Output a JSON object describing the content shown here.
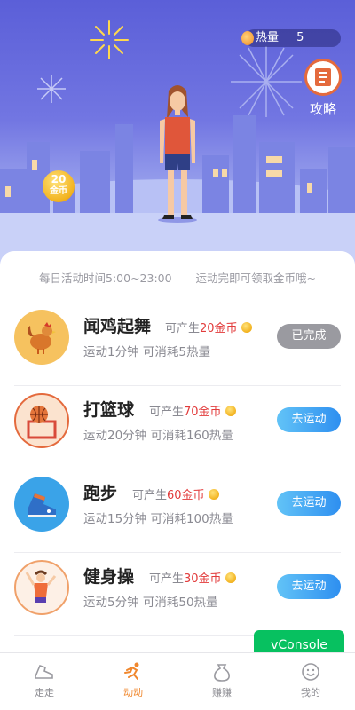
{
  "hero": {
    "heat_label": "热量",
    "heat_value": "5",
    "guide_label": "攻略",
    "coin_amount": "20",
    "coin_unit": "金币"
  },
  "hints": {
    "left": "每日活动时间5:00~23:00",
    "right": "运动完即可领取金币哦~"
  },
  "tasks": [
    {
      "title": "闻鸡起舞",
      "gain_prefix": "可产生",
      "gain_amount": "20金币",
      "desc": "运动1分钟 可消耗5热量",
      "button": "已完成",
      "done": true,
      "icon": "rooster-icon"
    },
    {
      "title": "打篮球",
      "gain_prefix": "可产生",
      "gain_amount": "70金币",
      "desc": "运动20分钟 可消耗160热量",
      "button": "去运动",
      "done": false,
      "icon": "basketball-icon"
    },
    {
      "title": "跑步",
      "gain_prefix": "可产生",
      "gain_amount": "60金币",
      "desc": "运动15分钟 可消耗100热量",
      "button": "去运动",
      "done": false,
      "icon": "sneaker-icon"
    },
    {
      "title": "健身操",
      "gain_prefix": "可产生",
      "gain_amount": "30金币",
      "desc": "运动5分钟 可消耗50热量",
      "button": "去运动",
      "done": false,
      "icon": "aerobics-icon"
    }
  ],
  "vconsole_label": "vConsole",
  "tabs": [
    {
      "label": "走走",
      "icon": "shoe-icon",
      "active": false
    },
    {
      "label": "动动",
      "icon": "runner-icon",
      "active": true
    },
    {
      "label": "赚赚",
      "icon": "money-bag-icon",
      "active": false
    },
    {
      "label": "我的",
      "icon": "smiley-icon",
      "active": false
    }
  ],
  "colors": {
    "accent_orange": "#f0872d",
    "button_blue": "#2e8ff0",
    "coin_red": "#e23b3b",
    "done_gray": "#9a9aa0"
  }
}
